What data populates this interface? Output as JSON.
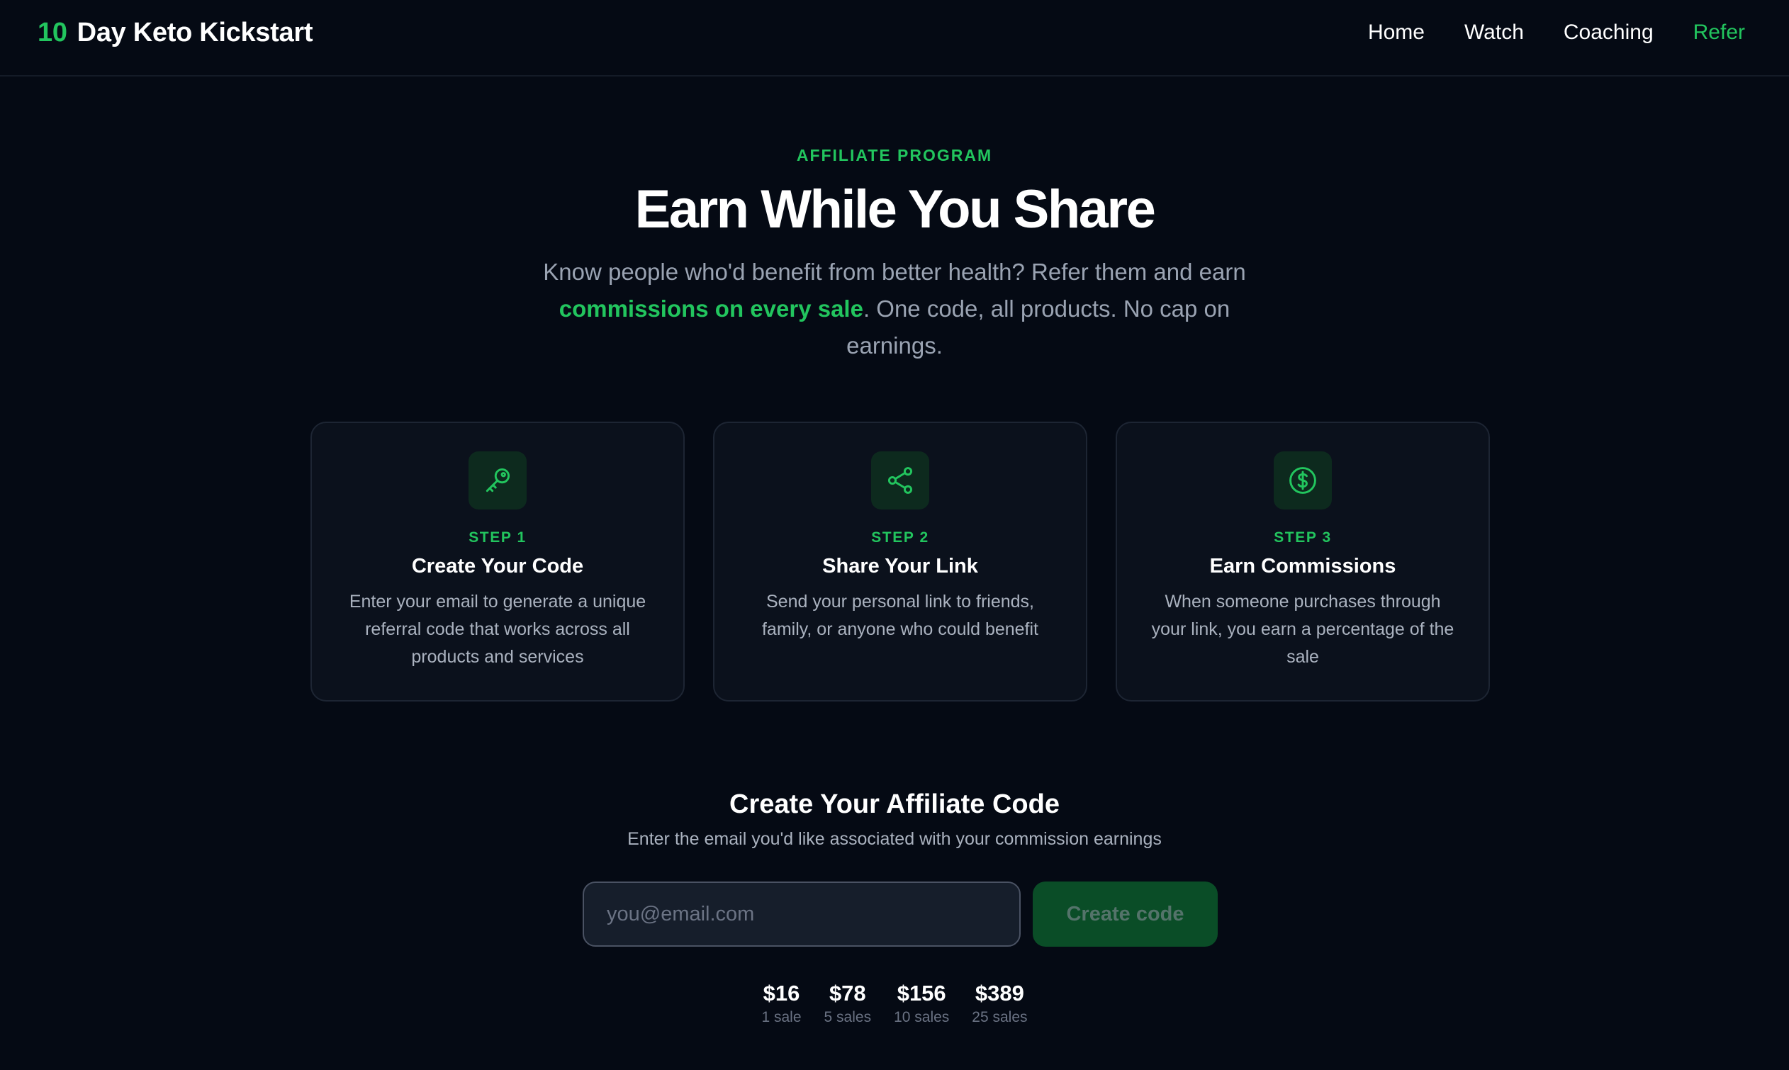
{
  "header": {
    "brand_num": "10",
    "brand_name": "Day Keto Kickstart",
    "nav": [
      "Home",
      "Watch",
      "Coaching",
      "Refer"
    ],
    "active_nav": "Refer"
  },
  "hero": {
    "eyebrow": "AFFILIATE PROGRAM",
    "title": "Earn While You Share",
    "sub_before": "Know people who'd benefit from better health? Refer them and earn ",
    "sub_highlight": "commissions on every sale",
    "sub_after": ". One code, all products. No cap on earnings."
  },
  "steps": [
    {
      "icon": "key-icon",
      "label": "STEP 1",
      "title": "Create Your Code",
      "desc": "Enter your email to generate a unique referral code that works across all products and services"
    },
    {
      "icon": "share-icon",
      "label": "STEP 2",
      "title": "Share Your Link",
      "desc": "Send your personal link to friends, family, or anyone who could benefit"
    },
    {
      "icon": "dollar-circle-icon",
      "label": "STEP 3",
      "title": "Earn Commissions",
      "desc": "When someone purchases through your link, you earn a percentage of the sale"
    }
  ],
  "form": {
    "title": "Create Your Affiliate Code",
    "sub": "Enter the email you'd like associated with your commission earnings",
    "placeholder": "you@email.com",
    "value": "",
    "button": "Create code"
  },
  "earnings": [
    {
      "amount": "$16",
      "label": "1 sale"
    },
    {
      "amount": "$78",
      "label": "5 sales"
    },
    {
      "amount": "$156",
      "label": "10 sales"
    },
    {
      "amount": "$389",
      "label": "25 sales"
    }
  ],
  "colors": {
    "accent": "#22c55e",
    "background": "#050a14",
    "card": "#0b111c"
  }
}
